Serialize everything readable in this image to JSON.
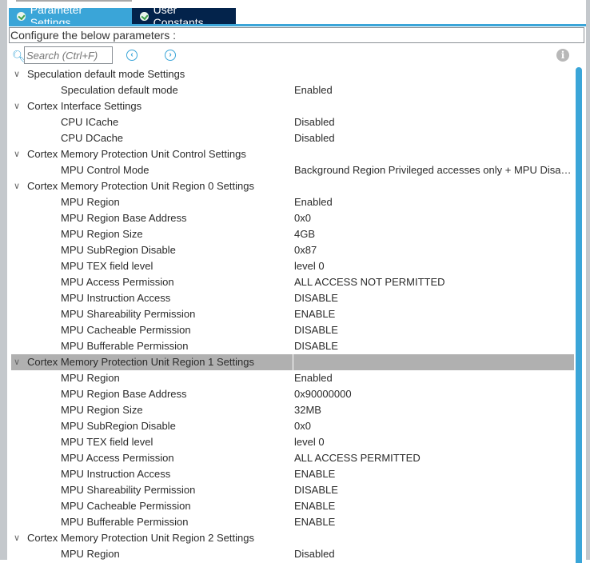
{
  "tabs": [
    {
      "label": "Parameter Settings"
    },
    {
      "label": "User Constants"
    }
  ],
  "configure_label": "Configure the below parameters :",
  "search": {
    "placeholder": "Search (Ctrl+F)"
  },
  "colors": {
    "accent": "#3aa5d8",
    "dark_tab": "#03234b",
    "selected_row": "#b0b0b0"
  },
  "groups": [
    {
      "title": "Speculation default mode Settings",
      "items": [
        {
          "name": "Speculation default mode",
          "value": "Enabled"
        }
      ]
    },
    {
      "title": "Cortex Interface Settings",
      "items": [
        {
          "name": "CPU ICache",
          "value": "Disabled"
        },
        {
          "name": "CPU DCache",
          "value": "Disabled"
        }
      ]
    },
    {
      "title": "Cortex Memory Protection Unit Control Settings",
      "items": [
        {
          "name": "MPU Control Mode",
          "value": "Background Region Privileged accesses only + MPU Disabled during hard fault"
        }
      ]
    },
    {
      "title": "Cortex Memory Protection Unit Region 0 Settings",
      "items": [
        {
          "name": "MPU Region",
          "value": "Enabled"
        },
        {
          "name": "MPU Region Base Address",
          "value": "0x0"
        },
        {
          "name": "MPU Region Size",
          "value": "4GB"
        },
        {
          "name": "MPU SubRegion Disable",
          "value": "0x87"
        },
        {
          "name": "MPU TEX field level",
          "value": "level 0"
        },
        {
          "name": "MPU Access Permission",
          "value": "ALL ACCESS NOT PERMITTED"
        },
        {
          "name": "MPU Instruction Access",
          "value": "DISABLE"
        },
        {
          "name": "MPU Shareability Permission",
          "value": "ENABLE"
        },
        {
          "name": "MPU Cacheable Permission",
          "value": "DISABLE"
        },
        {
          "name": "MPU Bufferable  Permission",
          "value": "DISABLE"
        }
      ]
    },
    {
      "title": "Cortex Memory Protection Unit Region 1 Settings",
      "selected": true,
      "items": [
        {
          "name": "MPU Region",
          "value": "Enabled"
        },
        {
          "name": "MPU Region Base Address",
          "value": "0x90000000"
        },
        {
          "name": "MPU Region Size",
          "value": "32MB"
        },
        {
          "name": "MPU SubRegion Disable",
          "value": "0x0"
        },
        {
          "name": "MPU TEX field level",
          "value": "level 0"
        },
        {
          "name": "MPU Access Permission",
          "value": "ALL ACCESS PERMITTED"
        },
        {
          "name": "MPU Instruction Access",
          "value": "ENABLE"
        },
        {
          "name": "MPU Shareability Permission",
          "value": "DISABLE"
        },
        {
          "name": "MPU Cacheable Permission",
          "value": "ENABLE"
        },
        {
          "name": "MPU Bufferable  Permission",
          "value": "ENABLE"
        }
      ]
    },
    {
      "title": "Cortex Memory Protection Unit Region 2 Settings",
      "items": [
        {
          "name": "MPU Region",
          "value": "Disabled"
        }
      ]
    }
  ]
}
